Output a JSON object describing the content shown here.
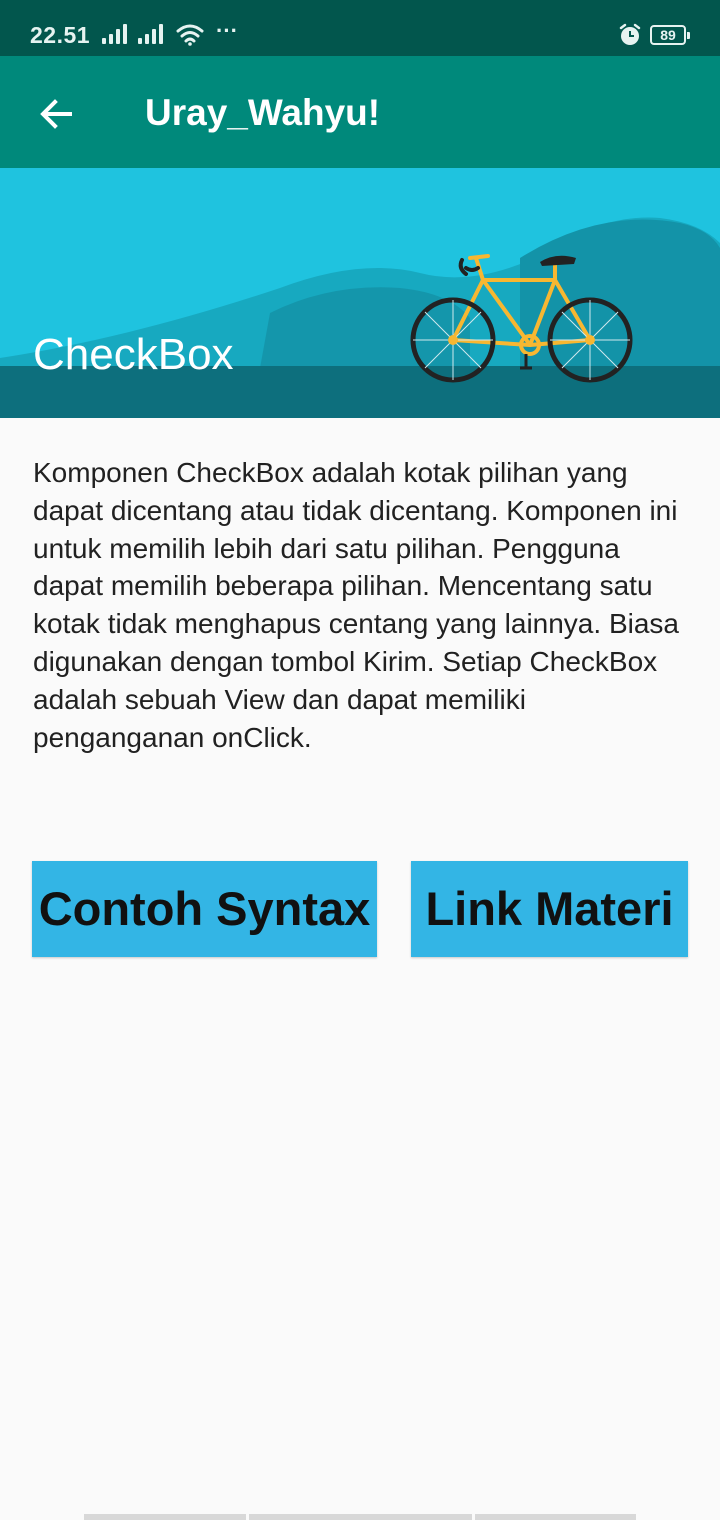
{
  "status_bar": {
    "time": "22.51",
    "battery": "89"
  },
  "app_bar": {
    "title": "Uray_Wahyu!"
  },
  "banner": {
    "title": "CheckBox"
  },
  "content": {
    "description": "Komponen CheckBox adalah kotak pilihan yang dapat dicentang atau tidak dicentang. Komponen ini untuk memilih lebih dari satu pilihan. Pengguna dapat memilih beberapa pilihan. Mencentang satu kotak tidak menghapus centang yang lainnya. Biasa digunakan dengan tombol Kirim. Setiap CheckBox adalah sebuah View dan dapat memiliki penganganan onClick."
  },
  "buttons": {
    "syntax_label": "Contoh Syntax",
    "materi_label": "Link Materi"
  },
  "icons": {
    "back": "arrow-back-icon",
    "signal": "signal-icon",
    "wifi": "wifi-icon",
    "alarm": "alarm-icon",
    "battery": "battery-icon",
    "more": "more-dots-icon"
  },
  "colors": {
    "status_bar": "#02564d",
    "app_bar": "#00897b",
    "banner_sky": "#1fc3df",
    "button": "#33b5e5",
    "bike_frame": "#f7b731"
  }
}
